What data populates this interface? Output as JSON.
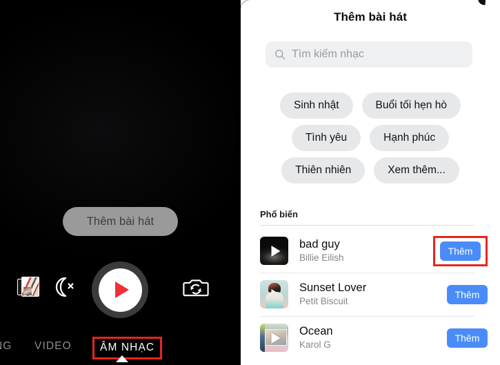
{
  "camera": {
    "add_song_pill_label": "Thêm bài hát",
    "controls": {
      "gallery_icon": "photo-stack-icon",
      "night_mode_icon": "moon-off-icon",
      "record_icon": "play-record-icon",
      "flip_camera_icon": "camera-flip-icon"
    },
    "mode_tabs": [
      {
        "label": "NG",
        "selected": false
      },
      {
        "label": "VIDEO",
        "selected": false
      },
      {
        "label": "ÂM NHẠC",
        "selected": true
      }
    ]
  },
  "sheet": {
    "title": "Thêm bài hát",
    "search": {
      "placeholder": "Tìm kiếm nhạc",
      "value": "",
      "icon": "search-icon"
    },
    "chips": [
      [
        "Sinh nhật",
        "Buổi tối hẹn hò"
      ],
      [
        "Tình yêu",
        "Hạnh phúc"
      ],
      [
        "Thiên nhiên",
        "Xem thêm..."
      ]
    ],
    "popular_header": "Phổ biến",
    "songs": [
      {
        "title": "bad guy",
        "artist": "Billie Eilish",
        "add_label": "Thêm",
        "highlighted": true
      },
      {
        "title": "Sunset Lover",
        "artist": "Petit Biscuit",
        "add_label": "Thêm",
        "highlighted": false
      },
      {
        "title": "Ocean",
        "artist": "Karol G",
        "add_label": "Thêm",
        "highlighted": false
      }
    ]
  },
  "colors": {
    "accent_blue": "#4a8cf7",
    "highlight_red": "#e8251d",
    "record_red": "#f02f38",
    "chip_gray": "#e7e8ea",
    "search_gray": "#eff0f2"
  }
}
